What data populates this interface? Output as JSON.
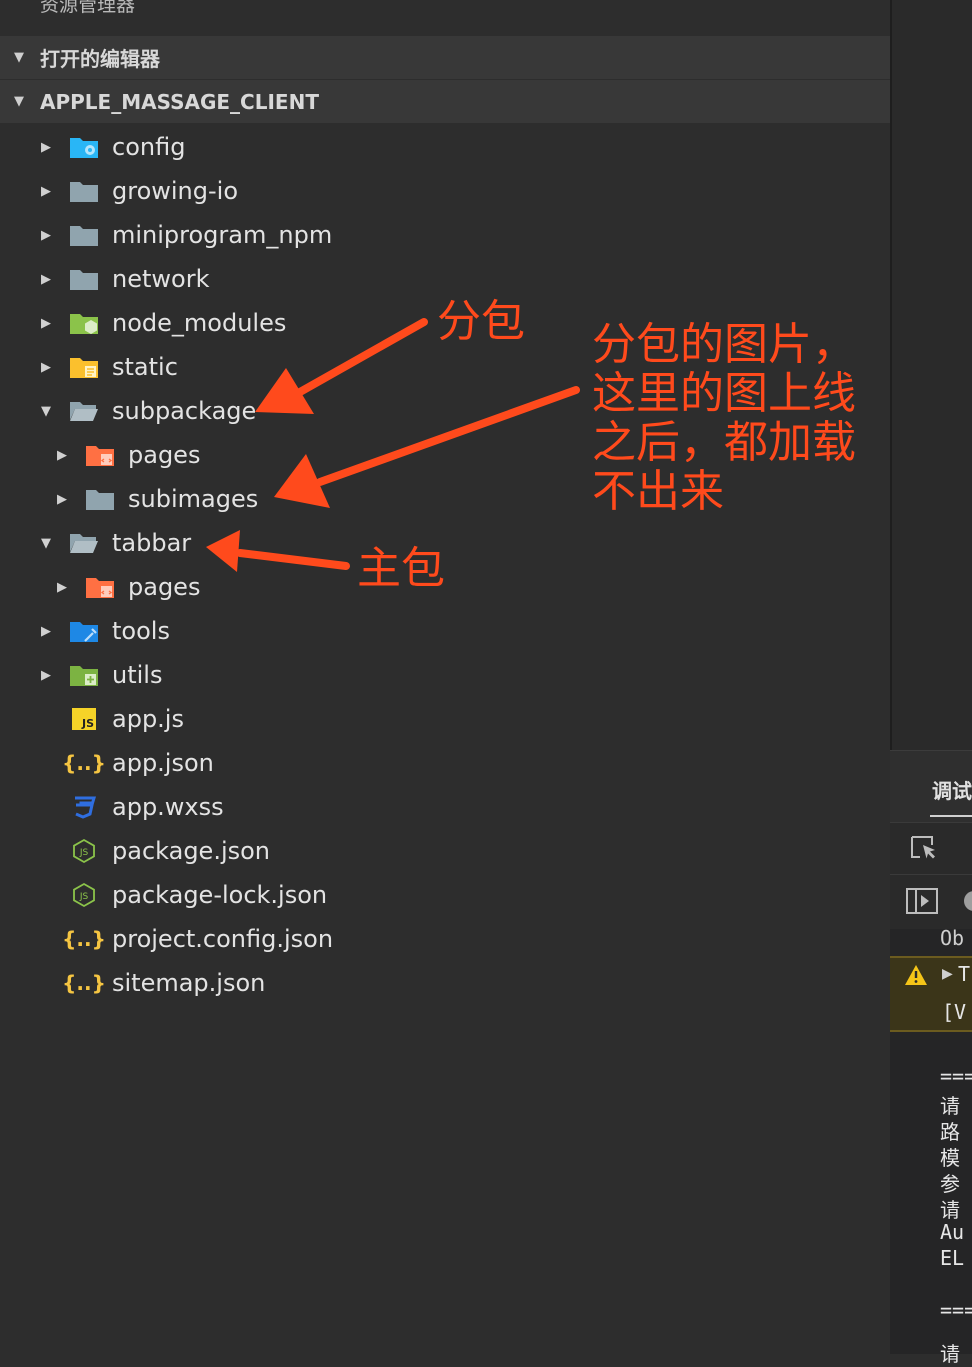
{
  "explorer": {
    "title": "资源管理器",
    "sections": [
      {
        "label": "打开的编辑器"
      },
      {
        "label": "APPLE_MASSAGE_CLIENT"
      }
    ],
    "items": [
      {
        "label": "config",
        "icon": "config-folder-icon",
        "expanded": false
      },
      {
        "label": "growing-io",
        "icon": "folder-icon",
        "expanded": false
      },
      {
        "label": "miniprogram_npm",
        "icon": "folder-icon",
        "expanded": false
      },
      {
        "label": "network",
        "icon": "folder-icon",
        "expanded": false
      },
      {
        "label": "node_modules",
        "icon": "node-modules-folder-icon",
        "expanded": false
      },
      {
        "label": "static",
        "icon": "static-folder-icon",
        "expanded": false
      },
      {
        "label": "subpackage",
        "icon": "folder-open-icon",
        "expanded": true
      },
      {
        "label": "pages",
        "icon": "pages-folder-icon",
        "expanded": false
      },
      {
        "label": "subimages",
        "icon": "folder-icon",
        "expanded": false
      },
      {
        "label": "tabbar",
        "icon": "folder-open-icon",
        "expanded": true
      },
      {
        "label": "pages",
        "icon": "pages-folder-icon",
        "expanded": false
      },
      {
        "label": "tools",
        "icon": "tools-folder-icon",
        "expanded": false
      },
      {
        "label": "utils",
        "icon": "utils-folder-icon",
        "expanded": false
      },
      {
        "label": "app.js",
        "icon": "js-file-icon"
      },
      {
        "label": "app.json",
        "icon": "json-file-icon"
      },
      {
        "label": "app.wxss",
        "icon": "css-file-icon"
      },
      {
        "label": "package.json",
        "icon": "node-json-file-icon"
      },
      {
        "label": "package-lock.json",
        "icon": "node-json-file-icon"
      },
      {
        "label": "project.config.json",
        "icon": "json-file-icon"
      },
      {
        "label": "sitemap.json",
        "icon": "json-file-icon"
      }
    ]
  },
  "annotations": {
    "subpackage": "分包",
    "subimages": [
      "分包的图片，",
      "这里的图上线",
      "之后，都加载",
      "不出来"
    ],
    "main": "主包"
  },
  "debug_panel": {
    "tab": "调试",
    "object_prefix": "Ob",
    "warning_line1": "T",
    "warning_line2": "[V",
    "console_lines": [
      "===",
      "请",
      "路",
      "模",
      "参",
      "请",
      "Au",
      "EL",
      "===",
      "请"
    ]
  },
  "colors": {
    "annotation": "#ff4a1c",
    "folder": "#90a4ae",
    "js": "#f5d328",
    "json": "#f5c542",
    "css": "#2f6ee0",
    "node": "#8bc34a"
  }
}
